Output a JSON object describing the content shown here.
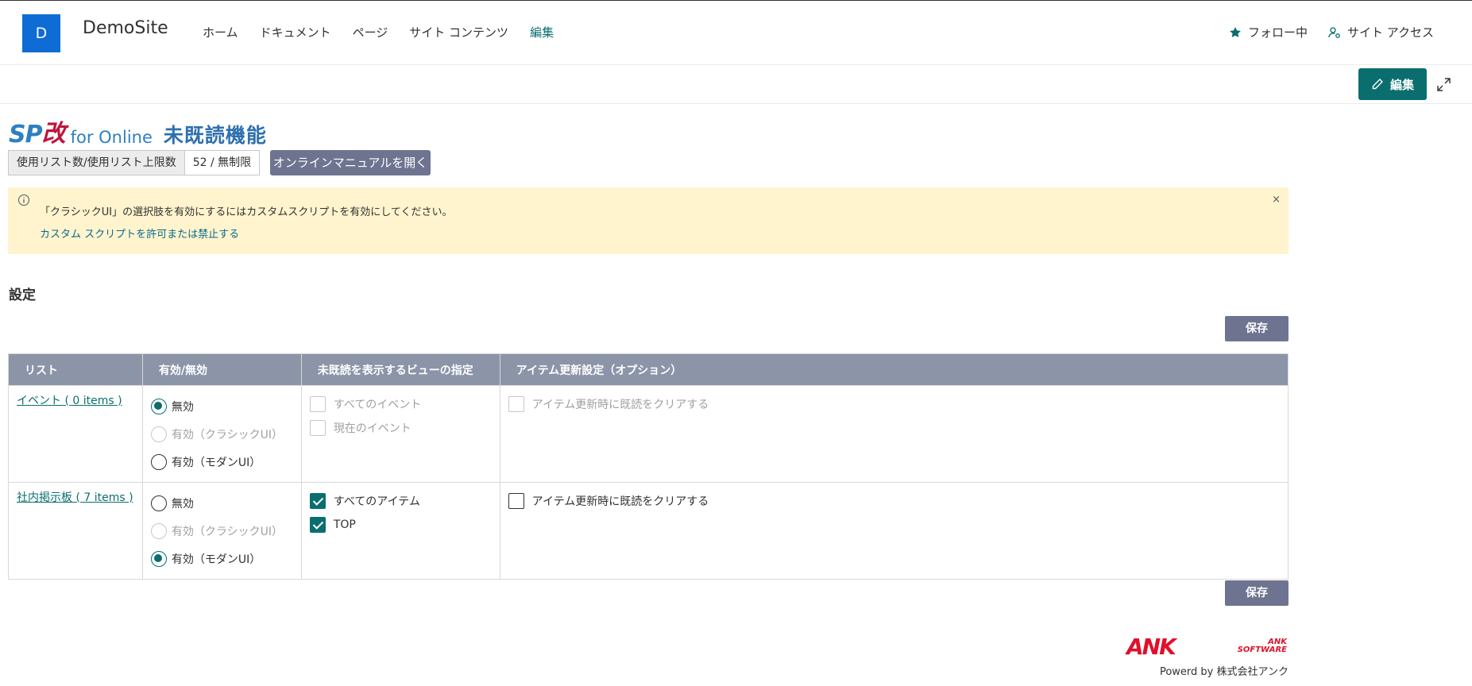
{
  "site": {
    "logo_letter": "D",
    "name": "DemoSite",
    "nav": [
      "ホーム",
      "ドキュメント",
      "ページ",
      "サイト コンテンツ",
      "編集"
    ],
    "follow_label": "フォロー中",
    "access_label": "サイト アクセス"
  },
  "command_bar": {
    "edit_label": "編集"
  },
  "app": {
    "logo_sp": "SP",
    "logo_kai": "改",
    "logo_online": "for Online",
    "logo_feature": "未既読機能",
    "usage_label": "使用リスト数/使用リスト上限数",
    "usage_value": "52 / 無制限",
    "manual_button": "オンラインマニュアルを開く"
  },
  "notice": {
    "text": "「クラシックUI」の選択肢を有効にするにはカスタムスクリプトを有効にしてください。",
    "link": "カスタム スクリプトを許可または禁止する",
    "close": "×"
  },
  "settings": {
    "title": "設定",
    "save_label": "保存",
    "columns": [
      "リスト",
      "有効/無効",
      "未既読を表示するビューの指定",
      "アイテム更新設定（オプション）"
    ],
    "rows": [
      {
        "list": "イベント ( 0 items )",
        "options": [
          {
            "label": "無効",
            "state": "checked"
          },
          {
            "label": "有効（クラシックUI）",
            "state": "disabled"
          },
          {
            "label": "有効（モダンUI）",
            "state": "unchecked"
          }
        ],
        "views": [
          {
            "label": "すべてのイベント",
            "state": "disabled"
          },
          {
            "label": "現在のイベント",
            "state": "disabled"
          }
        ],
        "update": {
          "label": "アイテム更新時に既読をクリアする",
          "state": "disabled"
        }
      },
      {
        "list": "社内掲示板 ( 7 items )",
        "options": [
          {
            "label": "無効",
            "state": "unchecked"
          },
          {
            "label": "有効（クラシックUI）",
            "state": "disabled"
          },
          {
            "label": "有効（モダンUI）",
            "state": "checked"
          }
        ],
        "views": [
          {
            "label": "すべてのアイテム",
            "state": "checked"
          },
          {
            "label": "TOP",
            "state": "checked"
          }
        ],
        "update": {
          "label": "アイテム更新時に既読をクリアする",
          "state": "unchecked"
        }
      }
    ]
  },
  "footer": {
    "logo_big": "ANK",
    "logo_small_1": "ANK",
    "logo_small_2": "SOFTWARE",
    "powered": "Powerd by 株式会社アンク"
  },
  "colors": {
    "accent": "#0b6e6e",
    "header_gray": "#8c94a8",
    "button_gray": "#6e7490",
    "notice_bg": "#fff4ce",
    "logo_blue": "#0f6cd4",
    "ank_red": "#e0102b"
  }
}
